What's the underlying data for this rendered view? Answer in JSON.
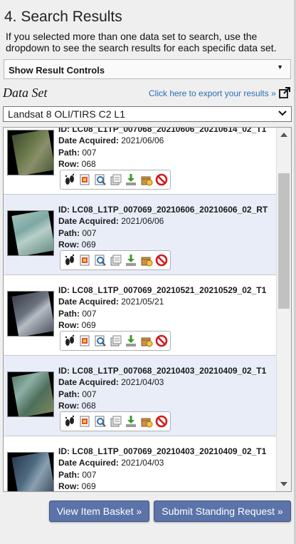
{
  "header": {
    "title": "4. Search Results",
    "description": "If you selected more than one data set to search, use the dropdown to see the search results for each specific data set."
  },
  "controls": {
    "label": "Show Result Controls"
  },
  "dataset": {
    "label": "Data Set",
    "export_link": "Click here to export your results »",
    "selected": "Landsat 8 OLI/TIRS C2 L1"
  },
  "results": [
    {
      "id": "LC08_L1TP_007068_20210606_20210614_02_T1",
      "acquired": "2021/06/06",
      "path": "007",
      "row": "068"
    },
    {
      "id": "LC08_L1TP_007069_20210606_20210606_02_RT",
      "acquired": "2021/06/06",
      "path": "007",
      "row": "069"
    },
    {
      "id": "LC08_L1TP_007069_20210521_20210529_02_T1",
      "acquired": "2021/05/21",
      "path": "007",
      "row": "069"
    },
    {
      "id": "LC08_L1TP_007068_20210403_20210409_02_T1",
      "acquired": "2021/04/03",
      "path": "007",
      "row": "068"
    },
    {
      "id": "LC08_L1TP_007069_20210403_20210409_02_T1",
      "acquired": "2021/04/03",
      "path": "007",
      "row": "069"
    }
  ],
  "labels": {
    "id": "ID:",
    "acquired": "Date Acquired:",
    "path": "Path:",
    "row": "Row:"
  },
  "tool_icons": [
    "footprint-icon",
    "overlay-icon",
    "metadata-icon",
    "compare-icon",
    "download-icon",
    "order-icon",
    "exclude-icon"
  ],
  "buttons": {
    "basket": "View Item Basket »",
    "standing": "Submit Standing Request »"
  },
  "colors": {
    "link": "#2a6fb5",
    "button": "#5b73a8",
    "row_alt": "#e8edf8"
  }
}
